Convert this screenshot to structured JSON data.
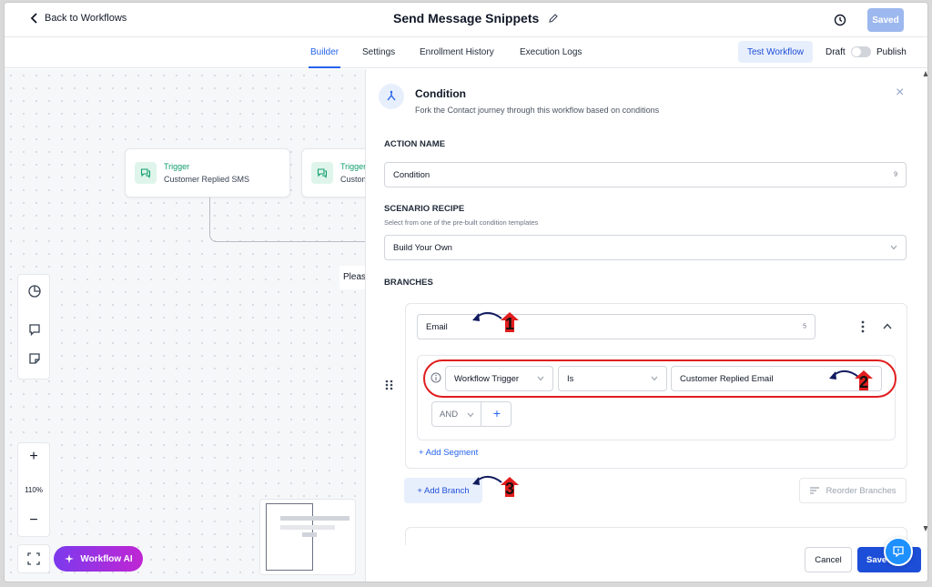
{
  "header": {
    "back_label": "Back to Workflows",
    "title": "Send Message Snippets",
    "saved_label": "Saved"
  },
  "tabs": [
    {
      "label": "Builder",
      "active": true
    },
    {
      "label": "Settings",
      "active": false
    },
    {
      "label": "Enrollment History",
      "active": false
    },
    {
      "label": "Execution Logs",
      "active": false
    }
  ],
  "tabbar": {
    "test_workflow_label": "Test Workflow",
    "draft_label": "Draft",
    "publish_label": "Publish"
  },
  "canvas": {
    "nodes": [
      {
        "label": "Trigger",
        "subtitle": "Customer Replied SMS"
      },
      {
        "label": "Trigger",
        "subtitle": "Customer Replied Email"
      }
    ],
    "partial_text": "Please",
    "zoom_level": "110%",
    "zoom_in": "+",
    "zoom_out": "−",
    "workflow_ai_label": "Workflow AI"
  },
  "panel": {
    "title": "Condition",
    "description": "Fork the Contact journey through this workflow based on conditions",
    "close": "×",
    "action_name_heading": "ACTION NAME",
    "action_name_value": "Condition",
    "action_name_count": "9",
    "scenario_heading": "SCENARIO RECIPE",
    "scenario_sub": "Select from one of the pre-built condition templates",
    "scenario_value": "Build Your Own",
    "branches_heading": "BRANCHES",
    "branch": {
      "name": "Email",
      "name_count": "5",
      "condition": {
        "field": "Workflow Trigger",
        "operator": "Is",
        "value": "Customer Replied Email"
      },
      "and_label": "AND",
      "plus_label": "+",
      "add_segment_label": "+ Add Segment"
    },
    "add_branch_label": "+ Add Branch",
    "reorder_label": "Reorder Branches",
    "cancel_label": "Cancel",
    "save_label": "Save"
  },
  "annotations": [
    "1",
    "2",
    "3"
  ],
  "colors": {
    "accent": "#2563eb",
    "annotation_red": "#e11d1d",
    "trigger_green": "#0f9d6b"
  }
}
